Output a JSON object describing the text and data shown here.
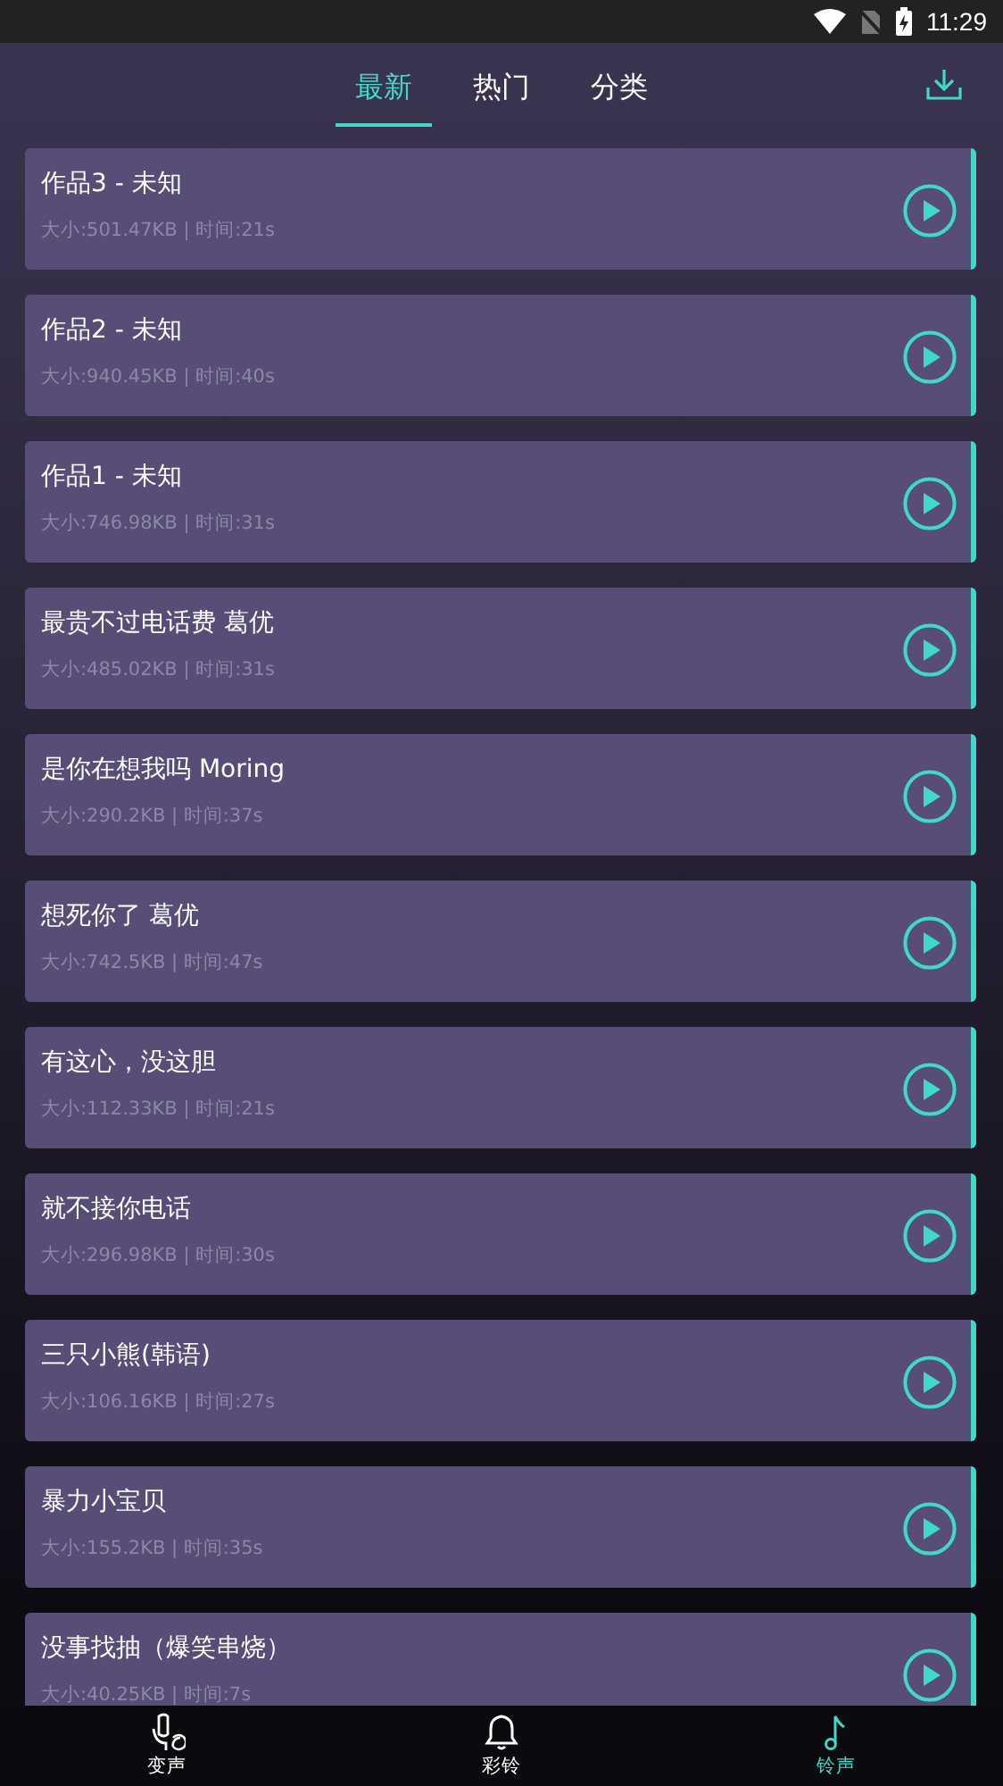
{
  "status_bar": {
    "time": "11:29"
  },
  "tabs": [
    {
      "label": "最新",
      "selected": true
    },
    {
      "label": "热门",
      "selected": false
    },
    {
      "label": "分类",
      "selected": false
    }
  ],
  "ringtones": [
    {
      "title": "作品3 - 未知",
      "meta": "大小:501.47KB | 时间:21s"
    },
    {
      "title": "作品2 - 未知",
      "meta": "大小:940.45KB | 时间:40s"
    },
    {
      "title": "作品1 - 未知",
      "meta": "大小:746.98KB | 时间:31s"
    },
    {
      "title": "最贵不过电话费 葛优",
      "meta": "大小:485.02KB | 时间:31s"
    },
    {
      "title": "是你在想我吗 Moring",
      "meta": "大小:290.2KB | 时间:37s"
    },
    {
      "title": "想死你了 葛优",
      "meta": "大小:742.5KB | 时间:47s"
    },
    {
      "title": "有这心，没这胆",
      "meta": "大小:112.33KB | 时间:21s"
    },
    {
      "title": "就不接你电话",
      "meta": "大小:296.98KB | 时间:30s"
    },
    {
      "title": "三只小熊(韩语)",
      "meta": "大小:106.16KB | 时间:27s"
    },
    {
      "title": "暴力小宝贝",
      "meta": "大小:155.2KB | 时间:35s"
    },
    {
      "title": "没事找抽（爆笑串烧）",
      "meta": "大小:40.25KB | 时间:7s"
    }
  ],
  "bottom_nav": [
    {
      "kind": "voice",
      "label": "变声",
      "selected": false
    },
    {
      "kind": "bell",
      "label": "彩铃",
      "selected": false
    },
    {
      "kind": "note",
      "label": "铃声",
      "selected": true
    }
  ]
}
